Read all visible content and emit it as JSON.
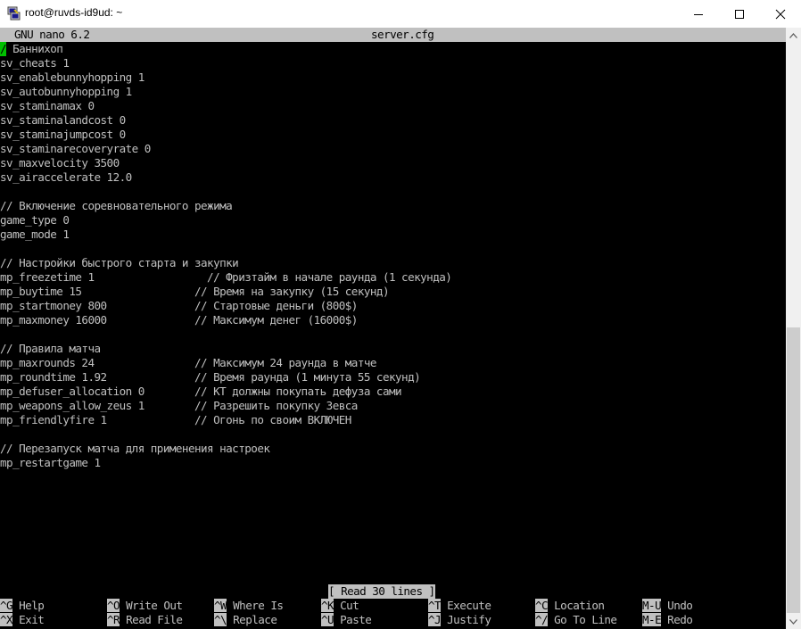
{
  "window": {
    "title": "root@ruvds-id9ud: ~"
  },
  "nano": {
    "version": "GNU nano 6.2",
    "filename": "server.cfg",
    "cursor_char": "/",
    "status": "[ Read 30 lines ]"
  },
  "lines": [
    "/ Баннихоп",
    "sv_cheats 1",
    "sv_enablebunnyhopping 1",
    "sv_autobunnyhopping 1",
    "sv_staminamax 0",
    "sv_staminalandcost 0",
    "sv_staminajumpcost 0",
    "sv_staminarecoveryrate 0",
    "sv_maxvelocity 3500",
    "sv_airaccelerate 12.0",
    "",
    "// Включение соревновательного режима",
    "game_type 0",
    "game_mode 1",
    "",
    "// Настройки быстрого старта и закупки",
    "mp_freezetime 1                  // Фризтайм в начале раунда (1 секунда)",
    "mp_buytime 15                  // Время на закупку (15 секунд)",
    "mp_startmoney 800              // Стартовые деньги (800$)",
    "mp_maxmoney 16000              // Максимум денег (16000$)",
    "",
    "// Правила матча",
    "mp_maxrounds 24                // Максимум 24 раунда в матче",
    "mp_roundtime 1.92              // Время раунда (1 минута 55 секунд)",
    "mp_defuser_allocation 0        // КТ должны покупать дефуза сами",
    "mp_weapons_allow_zeus 1        // Разрешить покупку Зевса",
    "mp_friendlyfire 1              // Огонь по своим ВКЛЮЧЕН",
    "",
    "// Перезапуск матча для применения настроек",
    "mp_restartgame 1"
  ],
  "shortcuts_row1": [
    {
      "key": "^G",
      "label": "Help"
    },
    {
      "key": "^O",
      "label": "Write Out"
    },
    {
      "key": "^W",
      "label": "Where Is"
    },
    {
      "key": "^K",
      "label": "Cut"
    },
    {
      "key": "^T",
      "label": "Execute"
    },
    {
      "key": "^C",
      "label": "Location"
    },
    {
      "key": "M-U",
      "label": "Undo"
    }
  ],
  "shortcuts_row2": [
    {
      "key": "^X",
      "label": "Exit"
    },
    {
      "key": "^R",
      "label": "Read File"
    },
    {
      "key": "^\\",
      "label": "Replace"
    },
    {
      "key": "^U",
      "label": "Paste"
    },
    {
      "key": "^J",
      "label": "Justify"
    },
    {
      "key": "^/",
      "label": "Go To Line"
    },
    {
      "key": "M-E",
      "label": "Redo"
    }
  ]
}
